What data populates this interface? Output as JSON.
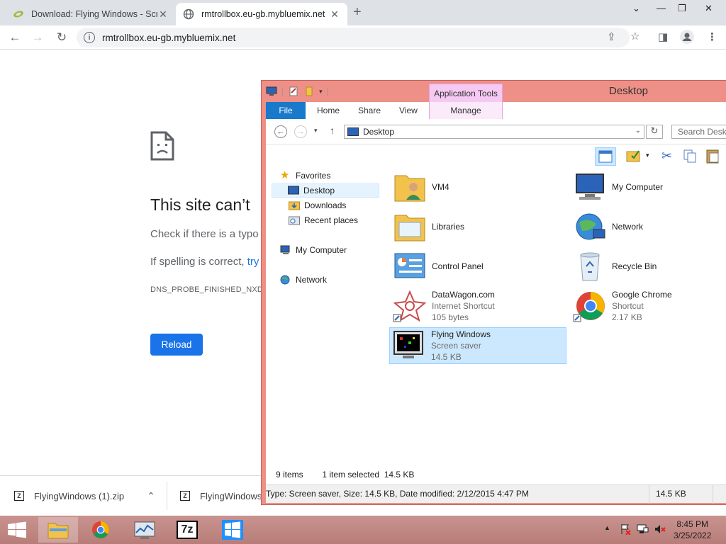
{
  "browser": {
    "tabs": [
      {
        "title": "Download: Flying Windows - Scr",
        "active": false
      },
      {
        "title": "rmtrollbox.eu-gb.mybluemix.net",
        "active": true
      }
    ],
    "address": "rmtrollbox.eu-gb.mybluemix.net"
  },
  "error_page": {
    "title": "This site can’t",
    "line1": "Check if there is a typo",
    "line2_prefix": "If spelling is correct, ",
    "line2_link": "try",
    "code": "DNS_PROBE_FINISHED_NXDO",
    "reload_label": "Reload"
  },
  "downloads": [
    {
      "name": "FlyingWindows (1).zip"
    },
    {
      "name": "FlyingWindows"
    }
  ],
  "explorer": {
    "window_title": "Desktop",
    "context_tab_group": "Application Tools",
    "ribbon_tabs": [
      "File",
      "Home",
      "Share",
      "View",
      "Manage"
    ],
    "address": "Desktop",
    "search_placeholder": "Search Deskto",
    "nav": {
      "favorites": "Favorites",
      "desktop": "Desktop",
      "downloads": "Downloads",
      "recent": "Recent places",
      "my_computer": "My Computer",
      "network": "Network"
    },
    "items": [
      {
        "name": "VM4",
        "sub1": "",
        "sub2": ""
      },
      {
        "name": "My Computer",
        "sub1": "",
        "sub2": ""
      },
      {
        "name": "Libraries",
        "sub1": "",
        "sub2": ""
      },
      {
        "name": "Network",
        "sub1": "",
        "sub2": ""
      },
      {
        "name": "Control Panel",
        "sub1": "",
        "sub2": ""
      },
      {
        "name": "Recycle Bin",
        "sub1": "",
        "sub2": ""
      },
      {
        "name": "DataWagon.com",
        "sub1": "Internet Shortcut",
        "sub2": "105 bytes"
      },
      {
        "name": "Google Chrome",
        "sub1": "Shortcut",
        "sub2": "2.17 KB"
      },
      {
        "name": "Flying Windows",
        "sub1": "Screen saver",
        "sub2": "14.5 KB"
      }
    ],
    "status_count": "9 items",
    "status_selected": "1 item selected  14.5 KB",
    "details": "Type: Screen saver, Size: 14.5 KB, Date modified: 2/12/2015 4:47 PM",
    "details_size": "14.5 KB"
  },
  "taskbar": {
    "time": "8:45 PM",
    "date": "3/25/2022",
    "seven_zip_label": "7z"
  },
  "colors": {
    "explorer_frame": "#ee9087",
    "chrome_blue": "#1a73e8",
    "selection": "#cce8ff"
  }
}
